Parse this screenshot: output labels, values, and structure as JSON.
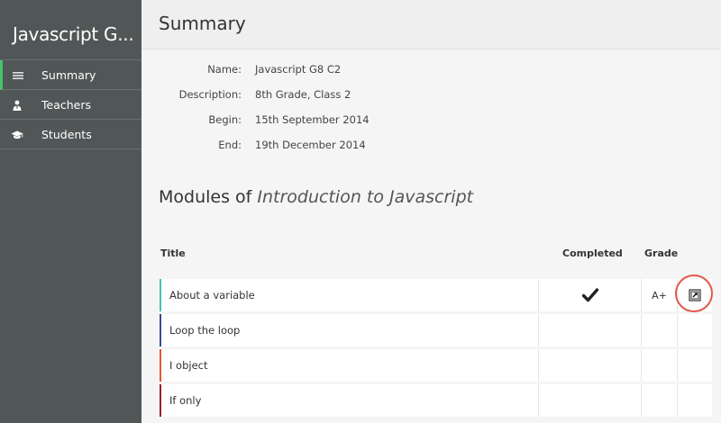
{
  "app": {
    "title": "Javascript G..."
  },
  "nav": {
    "items": [
      {
        "label": "Summary",
        "icon": "list-icon",
        "active": true
      },
      {
        "label": "Teachers",
        "icon": "teacher-icon",
        "active": false
      },
      {
        "label": "Students",
        "icon": "graduation-cap-icon",
        "active": false
      }
    ]
  },
  "page": {
    "title": "Summary"
  },
  "details": {
    "name_label": "Name:",
    "name_value": "Javascript G8 C2",
    "description_label": "Description:",
    "description_value": "8th Grade, Class 2",
    "begin_label": "Begin:",
    "begin_value": "15th September 2014",
    "end_label": "End:",
    "end_value": "19th December 2014"
  },
  "modules": {
    "heading_prefix": "Modules of",
    "heading_course": "Introduction to Javascript",
    "columns": {
      "title": "Title",
      "completed": "Completed",
      "grade": "Grade"
    },
    "rows": [
      {
        "title": "About a variable",
        "completed": true,
        "grade": "A+",
        "accent": "#3fc5b8"
      },
      {
        "title": "Loop the loop",
        "completed": false,
        "grade": "",
        "accent": "#3a4a8c"
      },
      {
        "title": "I object",
        "completed": false,
        "grade": "",
        "accent": "#e8552f"
      },
      {
        "title": "If only",
        "completed": false,
        "grade": "",
        "accent": "#9c1f2a"
      }
    ],
    "checkmark": "✔"
  },
  "colors": {
    "sidebar": "#515757",
    "active_indicator": "#46c46e",
    "highlight_circle": "#e2584a"
  }
}
